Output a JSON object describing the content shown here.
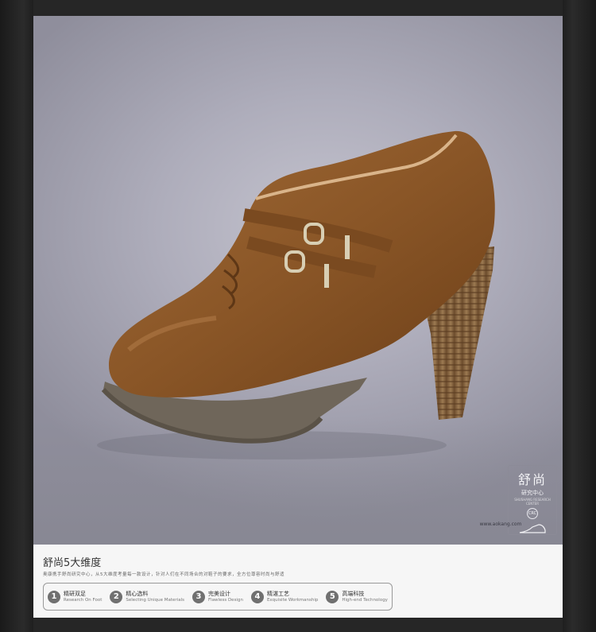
{
  "stamp": {
    "title": "舒尚",
    "subtitle": "研究中心",
    "tiny": "SHUSHANG RESEARCH CENTER",
    "badge": "CRC",
    "url": "www.aokang.com"
  },
  "panel": {
    "title": "舒尚5大维度",
    "subtitle": "奥康携手舒尚研究中心，从5大维度考量每一款设计，针对人们在不同场合的对鞋子的要求，全方位尊容时尚与舒适",
    "features": [
      {
        "num": "1",
        "cn": "精研双足",
        "en": "Research On Foot"
      },
      {
        "num": "2",
        "cn": "精心选料",
        "en": "Selecting Unique Materials"
      },
      {
        "num": "3",
        "cn": "完美设计",
        "en": "Flawless Design"
      },
      {
        "num": "4",
        "cn": "精湛工艺",
        "en": "Exquisite Workmanship"
      },
      {
        "num": "5",
        "cn": "高端科技",
        "en": "High-end Technology"
      }
    ]
  },
  "colors": {
    "leather": "#8a5a2b",
    "sole": "#6f665a",
    "heel_wood": "#8a6a46"
  }
}
